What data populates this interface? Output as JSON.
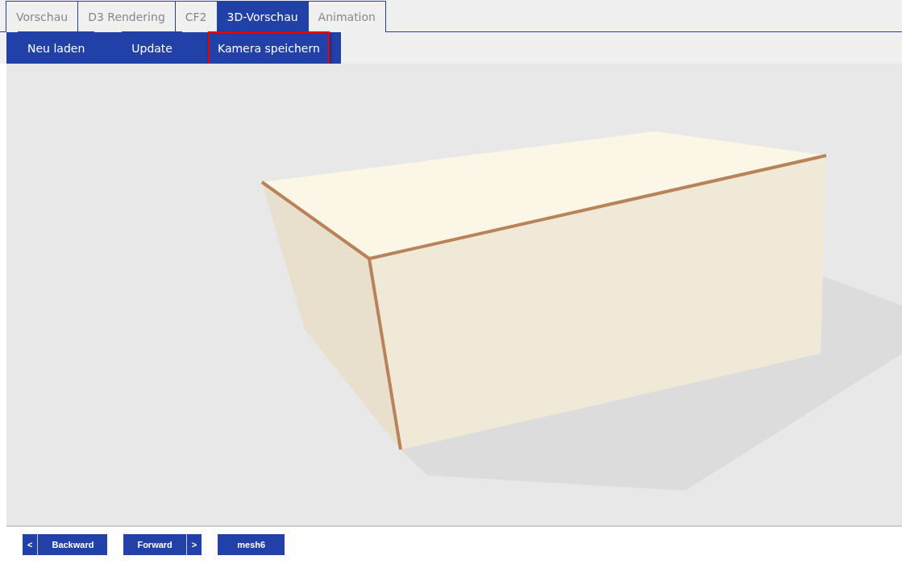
{
  "tabs": [
    {
      "label": "Vorschau",
      "selected": false
    },
    {
      "label": "D3 Rendering",
      "selected": false
    },
    {
      "label": "CF2",
      "selected": false
    },
    {
      "label": "3D-Vorschau",
      "selected": true
    },
    {
      "label": "Animation",
      "selected": false
    }
  ],
  "toolbar": [
    {
      "label": "Neu laden",
      "focused": false
    },
    {
      "label": "Update",
      "focused": false
    },
    {
      "label": "Kamera speichern",
      "focused": true
    }
  ],
  "navigation": [
    {
      "kind": "back",
      "arrow": "<",
      "label": "Backward"
    },
    {
      "kind": "forward",
      "arrow": ">",
      "label": "Forward"
    },
    {
      "kind": "plain",
      "label": "mesh6"
    }
  ]
}
